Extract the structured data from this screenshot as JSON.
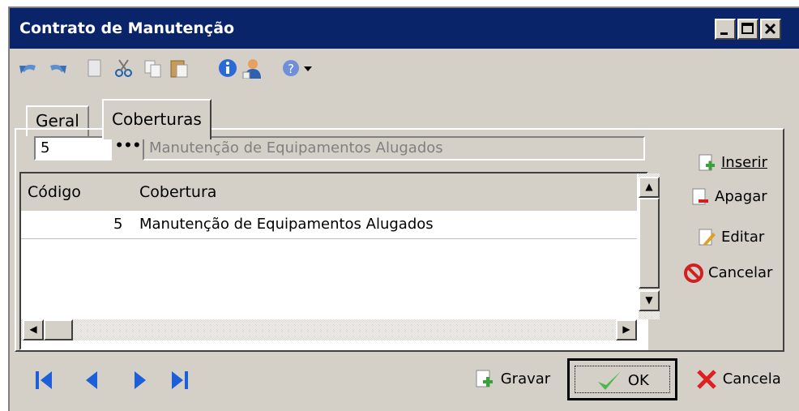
{
  "window": {
    "title": "Contrato de Manutenção"
  },
  "tabs": [
    {
      "label": "Geral"
    },
    {
      "label": "Coberturas"
    }
  ],
  "lookup": {
    "code": "5",
    "button": "•••",
    "description": "Manutenção de Equipamentos Alugados"
  },
  "grid": {
    "columns": [
      "Código",
      "Cobertura"
    ],
    "rows": [
      {
        "codigo": "5",
        "cobertura": "Manutenção de Equipamentos Alugados"
      }
    ]
  },
  "side_buttons": {
    "inserir": "Inserir",
    "apagar": "Apagar",
    "editar": "Editar",
    "cancelar": "Cancelar"
  },
  "bottom": {
    "gravar": "Gravar",
    "ok": "OK",
    "cancela": "Cancela"
  },
  "toolbar_icons": [
    "undo-icon",
    "redo-icon",
    "document-icon",
    "cut-icon",
    "copy-icon",
    "paste-icon",
    "info-icon",
    "user-icon",
    "help-icon",
    "dropdown-arrow-icon"
  ],
  "colors": {
    "titlebar": "#0a246a",
    "face": "#d4d0c8",
    "nav": "#1c5fd8"
  }
}
